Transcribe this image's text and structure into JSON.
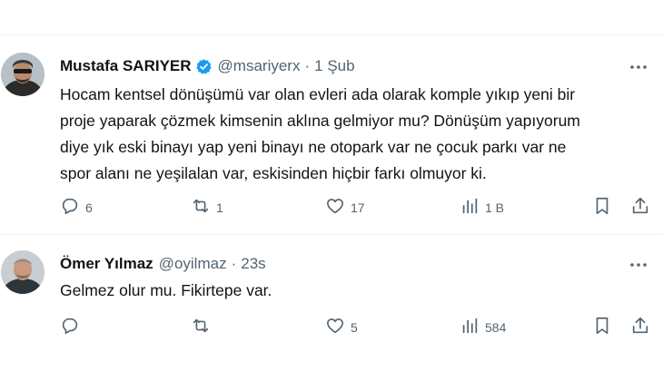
{
  "tweets": [
    {
      "display_name": "Mustafa SARIYER",
      "handle": "@msariyerx",
      "separator": "·",
      "time": "1 Şub",
      "text_lines": [
        "Hocam kentsel dönüşümü var olan evleri ada olarak komple yıkıp yeni bir",
        "proje yaparak çözmek kimsenin aklına gelmiyor mu? Dönüşüm yapıyorum",
        "diye yık eski binayı yap yeni binayı ne otopark var ne çocuk parkı var ne",
        "spor alanı ne yeşilalan var, eskisinden hiçbir farkı olmuyor ki."
      ],
      "reply_count": "6",
      "retweet_count": "1",
      "like_count": "17",
      "view_count": "1 B",
      "verified": true
    },
    {
      "display_name": "Ömer Yılmaz",
      "handle": "@oyilmaz",
      "separator": "·",
      "time": "23s",
      "text_lines": [
        "Gelmez olur mu. Fikirtepe var."
      ],
      "reply_count": "",
      "retweet_count": "",
      "like_count": "5",
      "view_count": "584",
      "verified": false
    }
  ],
  "colors": {
    "text": "#0f1419",
    "secondary": "#536471",
    "verified_badge": "#1d9bf0",
    "divider": "#eff3f4"
  },
  "icons": {
    "reply": "reply-icon",
    "retweet": "retweet-icon",
    "like": "heart-icon",
    "views": "views-chart-icon",
    "bookmark": "bookmark-icon",
    "share": "share-icon",
    "more": "more-dots-icon",
    "verified": "verified-badge-icon"
  }
}
